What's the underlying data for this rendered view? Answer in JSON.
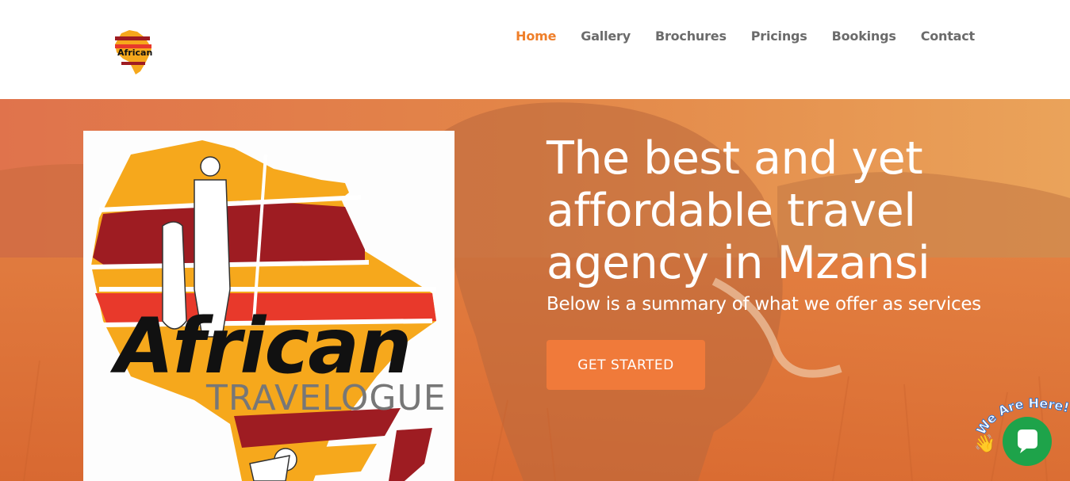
{
  "brand": {
    "logo_word": "African",
    "logo_sub": "TRAVELOGUE"
  },
  "nav": {
    "items": [
      {
        "label": "Home",
        "active": true
      },
      {
        "label": "Gallery",
        "active": false
      },
      {
        "label": "Brochures",
        "active": false
      },
      {
        "label": "Pricings",
        "active": false
      },
      {
        "label": "Bookings",
        "active": false
      },
      {
        "label": "Contact",
        "active": false
      }
    ]
  },
  "hero": {
    "title": "The best and yet affordable travel agency in Mzansi",
    "subtitle": "Below is a summary of what we offer as services",
    "cta_label": "GET STARTED"
  },
  "chat": {
    "badge_text": "We Are Here!"
  },
  "colors": {
    "accent": "#ef7f2a",
    "nav_text": "#6b6b6b",
    "cta": "#f07a3a",
    "chat": "#1ea34a",
    "logo_red": "#9e1c22",
    "logo_orange": "#f6a81c",
    "logo_bright_red": "#e8392b"
  }
}
